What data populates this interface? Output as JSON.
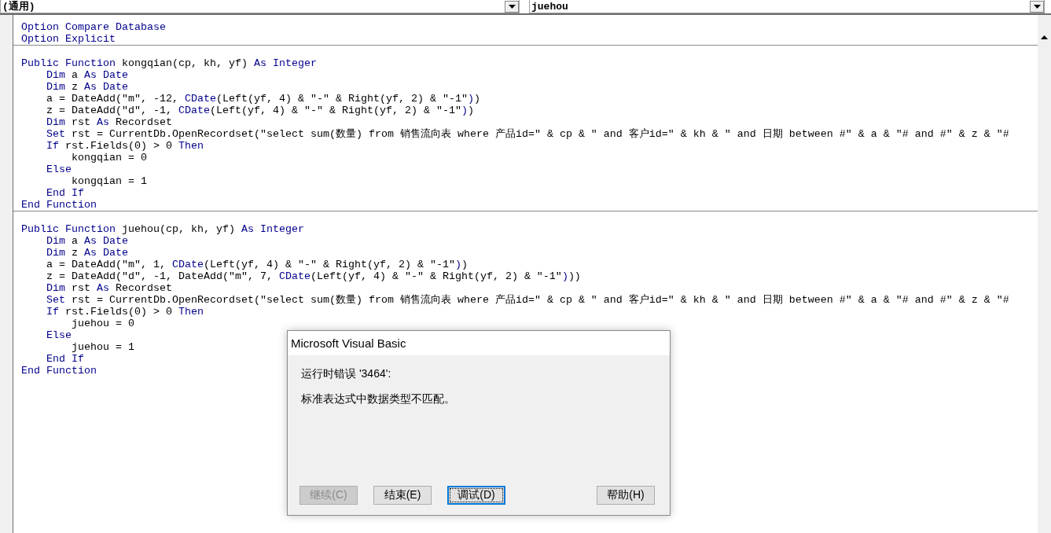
{
  "object_combo": {
    "value": "(通用)"
  },
  "procedure_combo": {
    "value": "juehou"
  },
  "procedures": [
    {
      "lines": [
        [
          {
            "kind": "keyword",
            "text": "Option Compare Database"
          }
        ],
        [
          {
            "kind": "keyword",
            "text": "Option Explicit"
          }
        ]
      ]
    },
    {
      "lines": [
        [
          {
            "kind": "keyword",
            "text": "Public Function"
          },
          {
            "kind": "plain",
            "text": " kongqian(cp, kh, yf) "
          },
          {
            "kind": "keyword",
            "text": "As Integer"
          }
        ],
        [
          {
            "kind": "keyword",
            "text": "    Dim"
          },
          {
            "kind": "plain",
            "text": " a "
          },
          {
            "kind": "keyword",
            "text": "As Date"
          }
        ],
        [
          {
            "kind": "keyword",
            "text": "    Dim"
          },
          {
            "kind": "plain",
            "text": " z "
          },
          {
            "kind": "keyword",
            "text": "As Date"
          }
        ],
        [
          {
            "kind": "plain",
            "text": "    a = DateAdd(\"m\", -12, "
          },
          {
            "kind": "keyword",
            "text": "CDate"
          },
          {
            "kind": "plain",
            "text": "(Left(yf, 4) & \"-\" & Right(yf, 2) & \"-1\""
          },
          {
            "kind": "keyword",
            "text": ")"
          },
          {
            "kind": "plain",
            "text": ")"
          }
        ],
        [
          {
            "kind": "plain",
            "text": "    z = DateAdd(\"d\", -1, "
          },
          {
            "kind": "keyword",
            "text": "CDate"
          },
          {
            "kind": "plain",
            "text": "(Left(yf, 4) & \"-\" & Right(yf, 2) & \"-1\""
          },
          {
            "kind": "keyword",
            "text": ")"
          },
          {
            "kind": "plain",
            "text": ")"
          }
        ],
        [
          {
            "kind": "keyword",
            "text": "    Dim"
          },
          {
            "kind": "plain",
            "text": " rst "
          },
          {
            "kind": "keyword",
            "text": "As"
          },
          {
            "kind": "plain",
            "text": " Recordset"
          }
        ],
        [
          {
            "kind": "keyword",
            "text": "    Set"
          },
          {
            "kind": "plain",
            "text": " rst = CurrentDb.OpenRecordset(\"select sum(数量) from 销售流向表 where 产品id=\" & cp & \" and 客户id=\" & kh & \" and 日期 between #\" & a & \"# and #\" & z & \"#"
          }
        ],
        [
          {
            "kind": "keyword",
            "text": "    If"
          },
          {
            "kind": "plain",
            "text": " rst.Fields(0) > 0 "
          },
          {
            "kind": "keyword",
            "text": "Then"
          }
        ],
        [
          {
            "kind": "plain",
            "text": "        kongqian = 0"
          }
        ],
        [
          {
            "kind": "keyword",
            "text": "    Else"
          }
        ],
        [
          {
            "kind": "plain",
            "text": "        kongqian = 1"
          }
        ],
        [
          {
            "kind": "keyword",
            "text": "    End If"
          }
        ],
        [
          {
            "kind": "keyword",
            "text": "End Function"
          }
        ]
      ]
    },
    {
      "lines": [
        [
          {
            "kind": "keyword",
            "text": "Public Function"
          },
          {
            "kind": "plain",
            "text": " juehou(cp, kh, yf) "
          },
          {
            "kind": "keyword",
            "text": "As Integer"
          }
        ],
        [
          {
            "kind": "keyword",
            "text": "    Dim"
          },
          {
            "kind": "plain",
            "text": " a "
          },
          {
            "kind": "keyword",
            "text": "As Date"
          }
        ],
        [
          {
            "kind": "keyword",
            "text": "    Dim"
          },
          {
            "kind": "plain",
            "text": " z "
          },
          {
            "kind": "keyword",
            "text": "As Date"
          }
        ],
        [
          {
            "kind": "plain",
            "text": "    a = DateAdd(\"m\", 1, "
          },
          {
            "kind": "keyword",
            "text": "CDate"
          },
          {
            "kind": "plain",
            "text": "(Left(yf, 4) & \"-\" & Right(yf, 2) & \"-1\""
          },
          {
            "kind": "keyword",
            "text": ")"
          },
          {
            "kind": "plain",
            "text": ")"
          }
        ],
        [
          {
            "kind": "plain",
            "text": "    z = DateAdd(\"d\", -1, DateAdd(\"m\", 7, "
          },
          {
            "kind": "keyword",
            "text": "CDate"
          },
          {
            "kind": "plain",
            "text": "(Left(yf, 4) & \"-\" & Right(yf, 2) & \"-1\""
          },
          {
            "kind": "keyword",
            "text": ")"
          },
          {
            "kind": "plain",
            "text": "))"
          }
        ],
        [
          {
            "kind": "keyword",
            "text": "    Dim"
          },
          {
            "kind": "plain",
            "text": " rst "
          },
          {
            "kind": "keyword",
            "text": "As"
          },
          {
            "kind": "plain",
            "text": " Recordset"
          }
        ],
        [
          {
            "kind": "keyword",
            "text": "    Set"
          },
          {
            "kind": "plain",
            "text": " rst = CurrentDb.OpenRecordset(\"select sum(数量) from 销售流向表 where 产品id=\" & cp & \" and 客户id=\" & kh & \" and 日期 between #\" & a & \"# and #\" & z & \"#"
          }
        ],
        [
          {
            "kind": "keyword",
            "text": "    If"
          },
          {
            "kind": "plain",
            "text": " rst.Fields(0) > 0 "
          },
          {
            "kind": "keyword",
            "text": "Then"
          }
        ],
        [
          {
            "kind": "plain",
            "text": "        juehou = 0"
          }
        ],
        [
          {
            "kind": "keyword",
            "text": "    Else"
          }
        ],
        [
          {
            "kind": "plain",
            "text": "        juehou = 1"
          }
        ],
        [
          {
            "kind": "keyword",
            "text": "    End If"
          }
        ],
        [
          {
            "kind": "keyword",
            "text": "End Function"
          }
        ]
      ]
    }
  ],
  "dialog": {
    "title": "Microsoft Visual Basic",
    "message": [
      "运行时错误 '3464':",
      "标准表达式中数据类型不匹配。"
    ],
    "buttons": [
      {
        "label": "继续(C)",
        "disabled": true,
        "focused": false
      },
      {
        "label": "结束(E)",
        "disabled": false,
        "focused": false
      },
      {
        "label": "调试(D)",
        "disabled": false,
        "focused": true
      },
      {
        "label": "帮助(H)",
        "disabled": false,
        "focused": false
      }
    ]
  }
}
